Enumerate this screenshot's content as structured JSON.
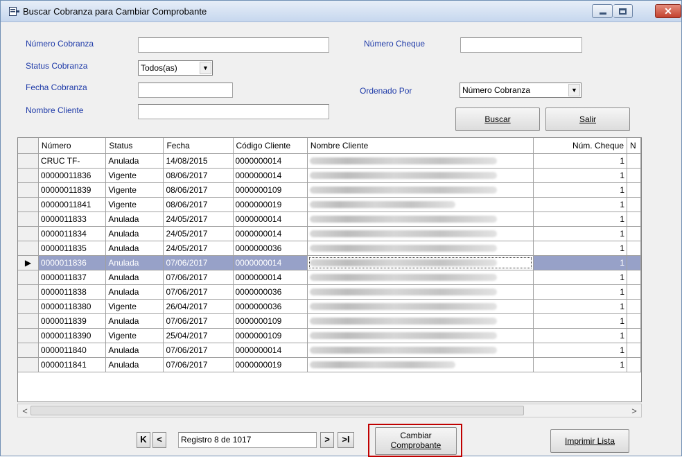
{
  "window": {
    "title": "Buscar Cobranza para Cambiar Comprobante",
    "close_glyph": "✕"
  },
  "form": {
    "numero_cobranza_label": "Número Cobranza",
    "numero_cobranza_value": "",
    "status_cobranza_label": "Status Cobranza",
    "status_cobranza_value": "Todos(as)",
    "fecha_cobranza_label": "Fecha Cobranza",
    "fecha_cobranza_value": "",
    "nombre_cliente_label": "Nombre Cliente",
    "nombre_cliente_value": "",
    "numero_cheque_label": "Número Cheque",
    "numero_cheque_value": "",
    "ordenado_por_label": "Ordenado Por",
    "ordenado_por_value": "Número Cobranza",
    "buscar_label": "Buscar",
    "salir_label": "Salir"
  },
  "grid": {
    "columns": [
      "Número",
      "Status",
      "Fecha",
      "Código Cliente",
      "Nombre Cliente",
      "Núm. Cheque",
      "N"
    ],
    "selected_indicator": "▶",
    "rows": [
      {
        "numero": "CRUC TF-",
        "status": "Anulada",
        "fecha": "14/08/2015",
        "codigo": "0000000014",
        "cheque": "1"
      },
      {
        "numero": "00000011836",
        "status": "Vigente",
        "fecha": "08/06/2017",
        "codigo": "0000000014",
        "cheque": "1"
      },
      {
        "numero": "00000011839",
        "status": "Vigente",
        "fecha": "08/06/2017",
        "codigo": "0000000109",
        "cheque": "1"
      },
      {
        "numero": "00000011841",
        "status": "Vigente",
        "fecha": "08/06/2017",
        "codigo": "0000000019",
        "cheque": "1"
      },
      {
        "numero": "0000011833",
        "status": "Anulada",
        "fecha": "24/05/2017",
        "codigo": "0000000014",
        "cheque": "1"
      },
      {
        "numero": "0000011834",
        "status": "Anulada",
        "fecha": "24/05/2017",
        "codigo": "0000000014",
        "cheque": "1"
      },
      {
        "numero": "0000011835",
        "status": "Anulada",
        "fecha": "24/05/2017",
        "codigo": "0000000036",
        "cheque": "1"
      },
      {
        "numero": "0000011836",
        "status": "Anulada",
        "fecha": "07/06/2017",
        "codigo": "0000000014",
        "cheque": "1"
      },
      {
        "numero": "0000011837",
        "status": "Anulada",
        "fecha": "07/06/2017",
        "codigo": "0000000014",
        "cheque": "1"
      },
      {
        "numero": "0000011838",
        "status": "Anulada",
        "fecha": "07/06/2017",
        "codigo": "0000000036",
        "cheque": "1"
      },
      {
        "numero": "00000118380",
        "status": "Vigente",
        "fecha": "26/04/2017",
        "codigo": "0000000036",
        "cheque": "1"
      },
      {
        "numero": "0000011839",
        "status": "Anulada",
        "fecha": "07/06/2017",
        "codigo": "0000000109",
        "cheque": "1"
      },
      {
        "numero": "00000118390",
        "status": "Vigente",
        "fecha": "25/04/2017",
        "codigo": "0000000109",
        "cheque": "1"
      },
      {
        "numero": "0000011840",
        "status": "Anulada",
        "fecha": "07/06/2017",
        "codigo": "0000000014",
        "cheque": "1"
      },
      {
        "numero": "0000011841",
        "status": "Anulada",
        "fecha": "07/06/2017",
        "codigo": "0000000019",
        "cheque": "1"
      }
    ]
  },
  "scroll": {
    "left_arrow": "<",
    "right_arrow": ">"
  },
  "nav": {
    "first_label": "K",
    "prev_label": "<",
    "record_text": "Registro 8 de 1017",
    "next_label": ">",
    "last_label": ">I",
    "cambiar_line1": "Cambiar",
    "cambiar_line2": "Comprobante",
    "imprimir_label": "Imprimir Lista"
  }
}
